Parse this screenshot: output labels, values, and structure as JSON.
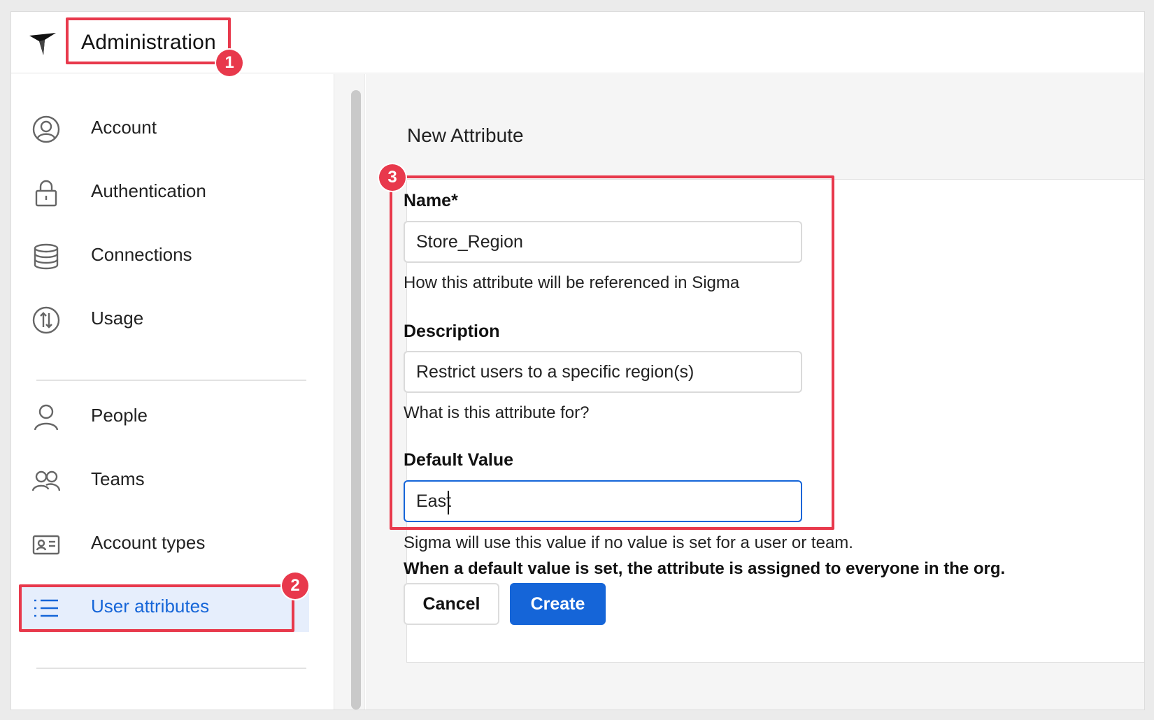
{
  "header": {
    "app_title": "Administration"
  },
  "sidebar": {
    "items": [
      {
        "label": "Account",
        "icon": "user-circle-icon"
      },
      {
        "label": "Authentication",
        "icon": "lock-icon"
      },
      {
        "label": "Connections",
        "icon": "database-icon"
      },
      {
        "label": "Usage",
        "icon": "usage-icon"
      },
      {
        "label": "People",
        "icon": "person-icon"
      },
      {
        "label": "Teams",
        "icon": "team-icon"
      },
      {
        "label": "Account types",
        "icon": "id-card-icon"
      },
      {
        "label": "User attributes",
        "icon": "list-icon",
        "active": true
      }
    ]
  },
  "main": {
    "page_title": "New Attribute",
    "form": {
      "name_label": "Name*",
      "name_value": "Store_Region",
      "name_help": "How this attribute will be referenced in Sigma",
      "description_label": "Description",
      "description_value": "Restrict users to a specific region(s)",
      "description_help": "What is this attribute for?",
      "default_label": "Default Value",
      "default_value": "East",
      "default_help": "Sigma will use this value if no value is set for a user or team.",
      "default_warning": "When a default value is set, the attribute is assigned to everyone in the org."
    },
    "buttons": {
      "cancel": "Cancel",
      "create": "Create"
    }
  },
  "annotations": {
    "marker_1": "1",
    "marker_2": "2",
    "marker_3": "3",
    "color": "#e8394c"
  },
  "colors": {
    "accent": "#1565d8",
    "active_bg": "#e6eefc"
  }
}
